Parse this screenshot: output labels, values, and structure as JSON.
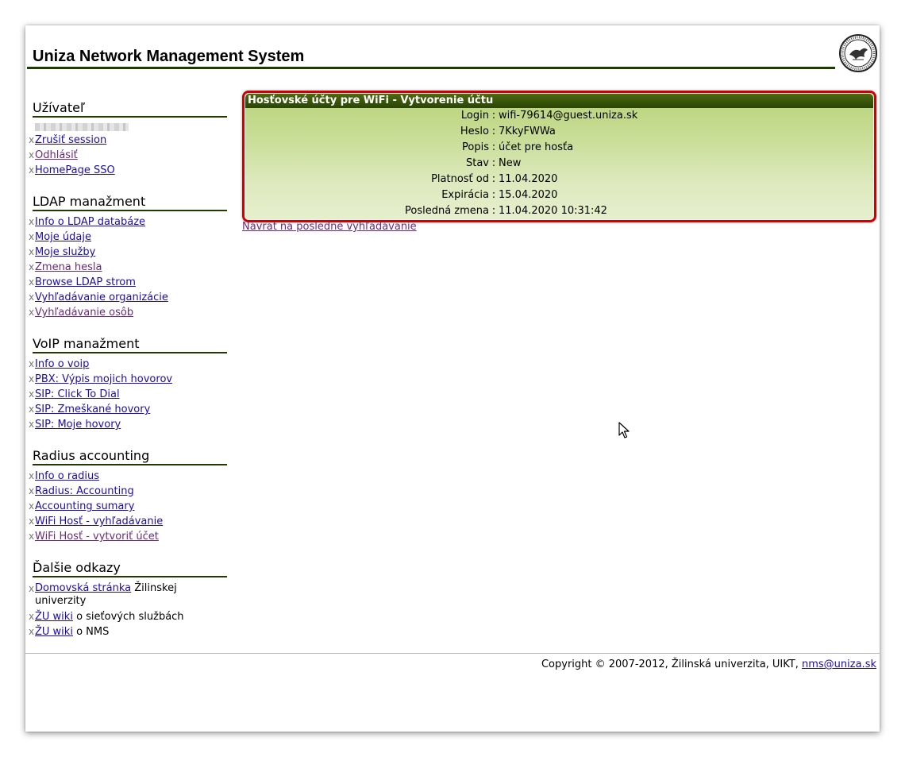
{
  "header": {
    "title": "Uniza Network Management System",
    "logo_icon": "university-seal-icon"
  },
  "sidebar": {
    "user_section": {
      "heading": "Užívateľ",
      "links": [
        "Zrušiť session",
        "Odhlásiť",
        "HomePage SSO"
      ]
    },
    "ldap_section": {
      "heading": "LDAP manažment",
      "links": [
        "Info o LDAP databáze",
        "Moje údaje",
        "Moje služby",
        "Zmena hesla",
        "Browse LDAP strom",
        "Vyhľadávanie organizácie",
        "Vyhľadávanie osôb"
      ]
    },
    "voip_section": {
      "heading": "VoIP manažment",
      "links": [
        "Info o voip",
        "PBX: Výpis mojich hovorov",
        "SIP: Click To Dial",
        "SIP: Zmeškané hovory",
        "SIP: Moje hovory"
      ]
    },
    "radius_section": {
      "heading": "Radius accounting",
      "links": [
        "Info o radius",
        "Radius: Accounting",
        "Accounting sumary",
        "WiFi Hosť - vyhľadávanie",
        "WiFi Hosť - vytvoriť účet"
      ]
    },
    "other_section": {
      "heading": "Ďalšie odkazy",
      "items": [
        {
          "link": "Domovská stránka",
          "text": " Žilinskej univerzity"
        },
        {
          "link": "ŽU wiki",
          "text": " o sieťových službách"
        },
        {
          "link": "ŽU wiki",
          "text": " o NMS"
        }
      ]
    },
    "bullet": "x"
  },
  "main": {
    "panel_title": "Hosťovské účty pre WiFi - Vytvorenie účtu",
    "rows": [
      {
        "key": "Login",
        "value": "wifi-79614@guest.uniza.sk"
      },
      {
        "key": "Heslo",
        "value": "7KkyFWWa"
      },
      {
        "key": "Popis",
        "value": "účet pre hosťa"
      },
      {
        "key": "Stav",
        "value": "New"
      },
      {
        "key": "Platnosť od",
        "value": "11.04.2020"
      },
      {
        "key": "Expirácia",
        "value": "15.04.2020"
      },
      {
        "key": "Posledná zmena",
        "value": "11.04.2020 10:31:42"
      }
    ],
    "separator": ":",
    "back_link": "Návrat na posledné vyhľadávanie"
  },
  "footer": {
    "copyright": "Copyright © 2007-2012, Žilinská univerzita, UIKT, ",
    "email": "nms@uniza.sk"
  },
  "colors": {
    "accent_dark_green": "#1f3b00",
    "highlight_red": "#d00000",
    "link": "#1a0dab",
    "visited_link": "#6b2a7b"
  }
}
